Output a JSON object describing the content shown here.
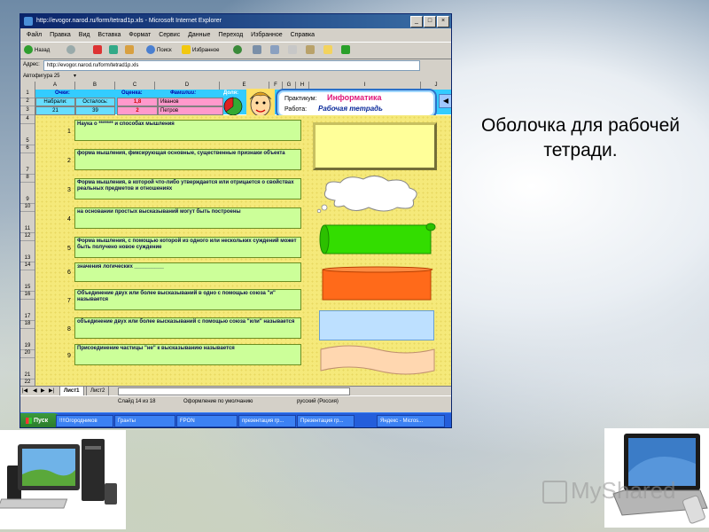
{
  "window": {
    "title": "http://evogor.narod.ru/form/tetrad1p.xls - Microsoft Internet Explorer",
    "controls": [
      "_",
      "□",
      "×"
    ]
  },
  "menu": [
    "Файл",
    "Правка",
    "Вид",
    "Вставка",
    "Формат",
    "Сервис",
    "Данные",
    "Переход",
    "Избранное",
    "Справка"
  ],
  "toolbar": {
    "back": "Назад",
    "search": "Поиск",
    "favorites": "Избранное"
  },
  "address": {
    "label": "Адрес:",
    "url": "http://evogor.narod.ru/form/tetrad1p.xls"
  },
  "drawbar": {
    "label": "Автофигура 25"
  },
  "sheet": {
    "columns": [
      "A",
      "B",
      "C",
      "D",
      "E",
      "F",
      "G",
      "H",
      "I",
      "J"
    ],
    "rows": [
      "1",
      "2",
      "3",
      "4",
      "5",
      "6",
      "7",
      "8",
      "9",
      "10",
      "11",
      "12",
      "13",
      "14",
      "15",
      "16",
      "17",
      "18",
      "19",
      "20",
      "21",
      "22"
    ],
    "header1": {
      "points": "Очки:",
      "grade": "Оценка:",
      "surnames": "Фамилии:",
      "share": "Доля:"
    },
    "header2": {
      "earned": "Набрали:",
      "remaining": "Осталось:",
      "grade": "1,8",
      "surname": "Иванов"
    },
    "header3": {
      "earned": "21",
      "remaining": "39",
      "grade": "2",
      "surname": "Петров"
    },
    "practicum": {
      "label": "Практикум:",
      "value": "Информатика",
      "work_label": "Работа:",
      "work_value": "Рабочая тетрадь"
    },
    "questions": [
      {
        "num": "1",
        "text": "Наука о ******* и способах мышления"
      },
      {
        "num": "2",
        "text": "форма мышления, фиксирующая основные, существенные признаки объекта"
      },
      {
        "num": "3",
        "text": "Форма мышления, в которой что-либо утверждается или отрицается о свойствах реальных предметов и отношениях"
      },
      {
        "num": "4",
        "text": "на основании простых высказываний могут быть построены"
      },
      {
        "num": "5",
        "text": "Форма мышления, с помощью которой из одного или нескольких суждений может быть получено новое суждение"
      },
      {
        "num": "6",
        "text": "значения логических __________"
      },
      {
        "num": "7",
        "text": "Объединение двух или более высказываний в одно с помощью союза \"и\" называется"
      },
      {
        "num": "8",
        "text": "объединение двух или более высказываний с помощью союза \"или\" называется"
      },
      {
        "num": "9",
        "text": "Присоединение частицы \"не\" к высказыванию называется"
      }
    ],
    "tabs": [
      "Лист1",
      "Лист2"
    ]
  },
  "status": {
    "slide": "Слайд 14 из 18",
    "design": "Оформление по умолчанию",
    "lang": "русский (Россия)"
  },
  "taskbar": {
    "start": "Пуск",
    "items": [
      "!!!!Огородников",
      "Гранты",
      "FPON",
      "презентация гр...",
      "Презентация гр...",
      "Яндекс - Micros..."
    ]
  },
  "caption": "Оболочка для рабочей тетради.",
  "watermark": "MyShared",
  "colors": {
    "accent": "#33ccff",
    "answer_green": "#33dd00",
    "answer_orange": "#ff6a1a",
    "answer_blue": "#bde0ff",
    "answer_peach": "#ffd7b0"
  }
}
